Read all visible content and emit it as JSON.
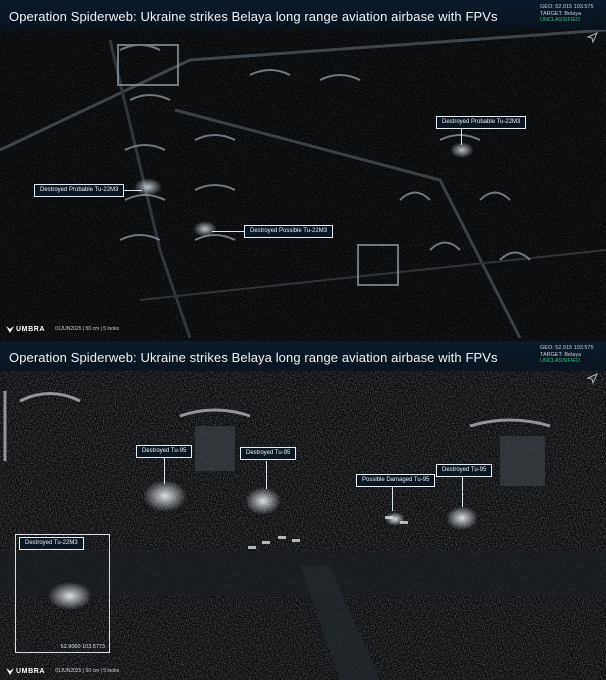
{
  "panels": [
    {
      "title": "Operation Spiderweb: Ukraine strikes Belaya long range aviation airbase with FPVs",
      "meta": {
        "geo": "GEO: 52.915 103.575",
        "target": "TARGET: Belaya",
        "classification": "UNCLASSIFIED"
      },
      "labels": [
        "Destroyed Probable Tu-22M3",
        "Destroyed Probable Tu-22M3",
        "Destroyed Possible Tu-22M3"
      ],
      "footer": {
        "logo": "UMBRA",
        "caption": "01JUN2025 | 50 cm | 5 looks"
      }
    },
    {
      "title": "Operation Spiderweb: Ukraine strikes Belaya long range aviation airbase with FPVs",
      "meta": {
        "geo": "GEO: 52.915 103.575",
        "target": "TARGET: Belaya",
        "classification": "UNCLASSIFIED"
      },
      "labels": [
        "Destroyed Tu-95",
        "Destroyed Tu-95",
        "Possible Damaged Tu-95",
        "Destroyed Tu-95"
      ],
      "inset": {
        "label": "Destroyed Tu-22M3",
        "coordinates": "52.9060 103.5773"
      },
      "footer": {
        "logo": "UMBRA",
        "caption": "01JUN2025 | 50 cm | 5 looks"
      }
    }
  ],
  "colors": {
    "header": "#0b1a2a",
    "label_bg": "#0b1623",
    "label_border": "#e8eef4",
    "unclassified": "#27c46a"
  }
}
